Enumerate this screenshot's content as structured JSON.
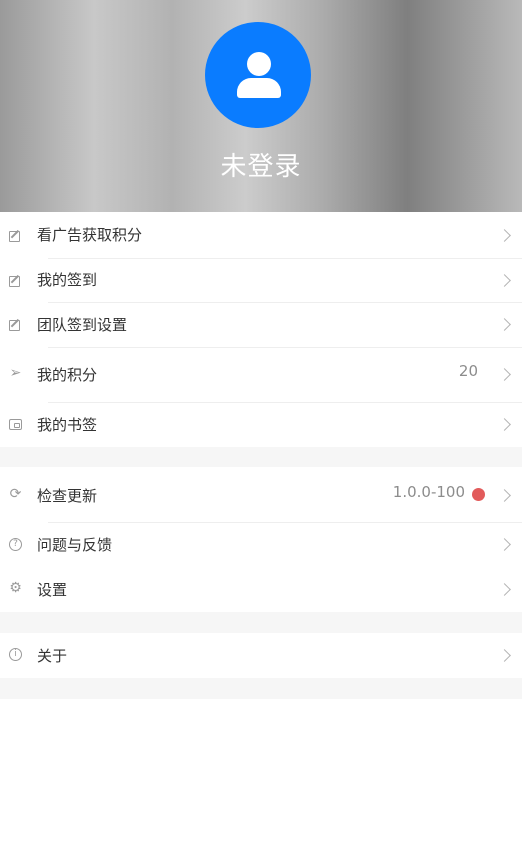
{
  "profile": {
    "login_label": "未登录",
    "avatar_color": "#0a7cff",
    "avatar_icon": "user-icon"
  },
  "menu": {
    "group1": [
      {
        "icon": "edit-icon",
        "label": "看广告获取积分"
      },
      {
        "icon": "edit-icon",
        "label": "我的签到"
      },
      {
        "icon": "edit-icon",
        "label": "团队签到设置"
      },
      {
        "icon": "send-icon",
        "label": "我的积分",
        "value": "20"
      },
      {
        "icon": "wallet-icon",
        "label": "我的书签"
      }
    ],
    "group2": [
      {
        "icon": "refresh-icon",
        "label": "检查更新",
        "value": "1.0.0-100",
        "badge_color": "#e25b5b"
      },
      {
        "icon": "help-icon",
        "label": "问题与反馈"
      },
      {
        "icon": "gear-icon",
        "label": "设置"
      }
    ],
    "group3": [
      {
        "icon": "info-icon",
        "label": "关于"
      }
    ]
  }
}
